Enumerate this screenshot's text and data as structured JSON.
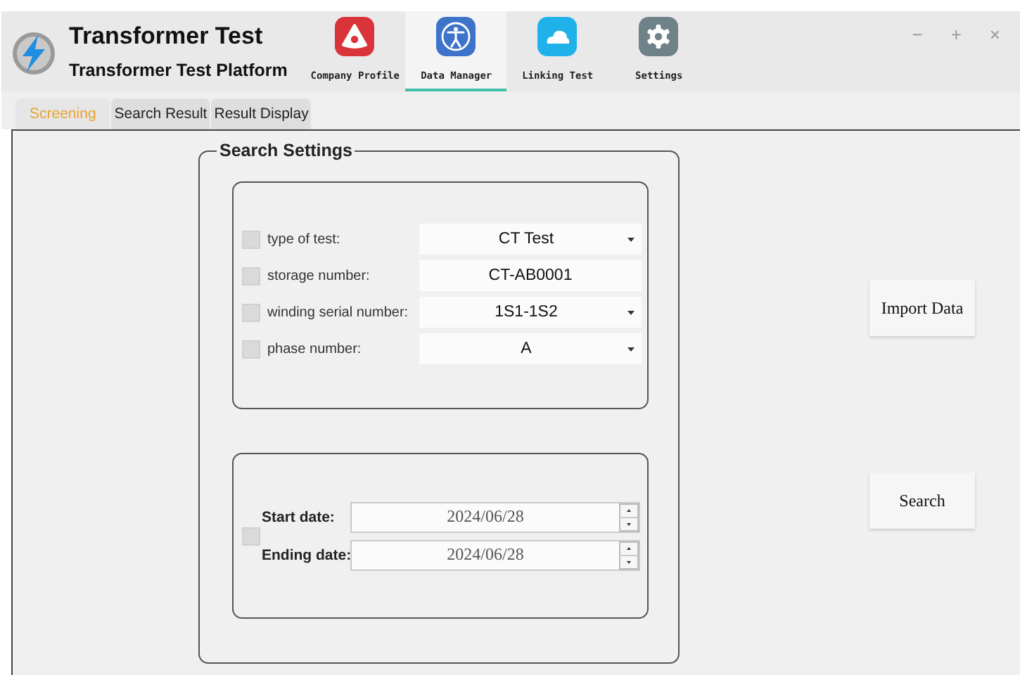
{
  "window": {
    "title": "Transformer Test",
    "subtitle": "Transformer Test Platform",
    "controls": [
      "−",
      "+",
      "×"
    ]
  },
  "nav": [
    {
      "label": "Company Profile",
      "kind": "profile",
      "selected": false
    },
    {
      "label": "Data Manager",
      "kind": "data",
      "selected": true
    },
    {
      "label": "Linking Test",
      "kind": "link",
      "selected": false
    },
    {
      "label": "Settings",
      "kind": "settings",
      "selected": false
    }
  ],
  "tabs": [
    {
      "label": "Screening",
      "selected": true
    },
    {
      "label": "Search Result",
      "selected": false
    },
    {
      "label": "Result Display",
      "selected": false
    }
  ],
  "search_settings": {
    "title": "Search Settings",
    "filters": [
      {
        "kind": "dropdown",
        "label": "type of test:",
        "value": "CT Test",
        "checked": false
      },
      {
        "kind": "text",
        "label": "storage number:",
        "value": "CT-AB0001",
        "checked": false
      },
      {
        "kind": "dropdown",
        "label": "winding serial number:",
        "value": "1S1-1S2",
        "checked": false
      },
      {
        "kind": "dropdown",
        "label": "phase number:",
        "value": "A",
        "checked": false
      }
    ],
    "date_filter": {
      "checked": false,
      "dates": [
        {
          "label": "Start date:",
          "value": "2024/06/28"
        },
        {
          "label": "Ending date:",
          "value": "2024/06/28"
        }
      ]
    }
  },
  "buttons": [
    {
      "label": "Import Data"
    },
    {
      "label": "Search"
    }
  ]
}
